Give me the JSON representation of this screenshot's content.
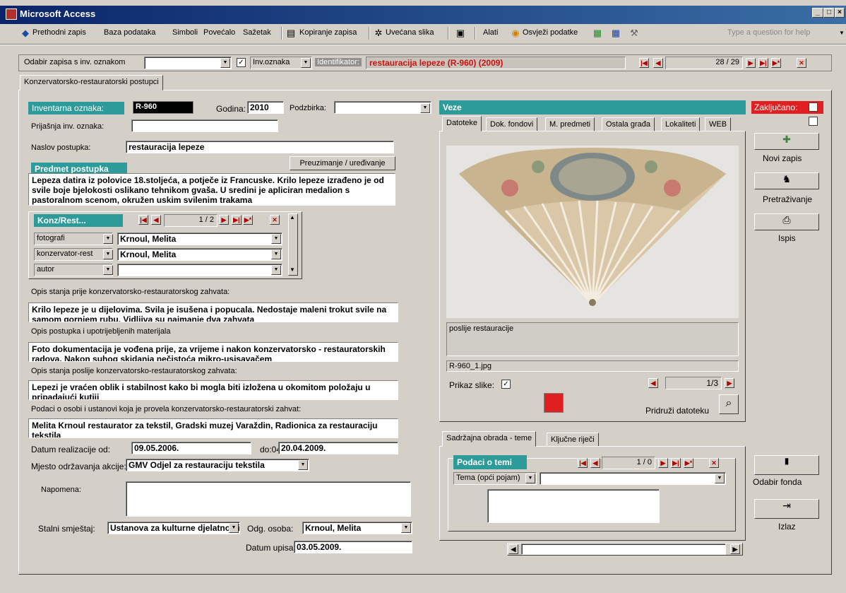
{
  "window": {
    "title": "Microsoft Access"
  },
  "menu": {
    "items": [
      "Prethodni zapis",
      "Baza podataka",
      "Simboli",
      "Povećalo",
      "Sažetak",
      "Kopiranje zapisa",
      "Uvećana slika",
      "Alati",
      "Osvježi podatke"
    ],
    "question_placeholder": "Type a question for help"
  },
  "record_bar": {
    "selector_label": "Odabir zapisa s inv. oznakom",
    "selector_value": "",
    "inv_oznaka_option": "Inv.oznaka",
    "inv_oznaka_checked": true,
    "identifier_label": "Identifikator:",
    "identifier_value": "restauracija lepeze (R-960) (2009)",
    "position": "28 / 29"
  },
  "form_tab": "Konzervatorsko-restauratorski postupci",
  "fields": {
    "inv_label": "Inventarna oznaka:",
    "inv_value": "R-960",
    "godina_label": "Godina:",
    "godina_value": "2010",
    "podzbirka_label": "Podzbirka:",
    "podzbirka_value": "",
    "prijasnja_label": "Prijašnja inv. oznaka:",
    "prijasnja_value": "",
    "naslov_label": "Naslov postupka:",
    "naslov_value": "restauracija lepeze",
    "preuzimanje_button": "Preuzimanje / uređivanje",
    "predmet_label": "Predmet postupka",
    "predmet_text": "Lepeza datira iz polovice 18.stoljeća, a potječe iz Francuske. Krilo lepeze izrađeno je od svile boje bjelokosti oslikano tehnikom gvaša. U sredini je apliciran medalion s pastoralnom scenom, okružen uskim svilenim trakama",
    "konz_label": "Konz/Rest...",
    "konz_position": "1 / 2",
    "roles": [
      {
        "role": "fotografi",
        "name": "Krnoul, Melita"
      },
      {
        "role": "konzervator-rest",
        "name": "Krnoul, Melita"
      },
      {
        "role": "autor",
        "name": ""
      }
    ],
    "opis_prije_label": "Opis stanja prije konzervatorsko-restauratorskog zahvata:",
    "opis_prije_text": "Krilo lepeze je u dijelovima. Svila je isušena i popucala. Nedostaje maleni trokut svile na samom gornjem rubu. Vidljiva su najmanje dva zahvata",
    "opis_postupka_label": "Opis postupka i upotrijebljenih materijala",
    "opis_postupka_text": "Foto dokumentacija je vođena prije, za vrijeme i nakon konzervatorsko - restauratorskih radova. Nakon suhog skidanja nečistoća mikro-usisavačem",
    "opis_poslije_label": "Opis stanja poslije konzervatorsko-restauratorskog zahvata:",
    "opis_poslije_text": "Lepezi je vraćen oblik i stabilnost kako bi mogla biti izložena u okomitom položaju u pripadajući kutiji",
    "podaci_osobi_label": "Podaci o osobi i ustanovi koja je provela konzervatorsko-restauratorski zahvat:",
    "podaci_osobi_text": "Melita Krnoul restaurator za tekstil, Gradski muzej Varaždin, Radionica za restauraciju tekstila",
    "datum_od_label": "Datum realizacije od:",
    "datum_od_value": "09.05.2006.",
    "datum_do_label": "do:",
    "datum_do_value": "20.04.2009.",
    "mjesto_label": "Mjesto održavanja akcije:",
    "mjesto_value": "GMV Odjel za restauraciju tekstila",
    "napomena_label": "Napomena:",
    "napomena_value": "",
    "smjestaj_label": "Stalni smještaj:",
    "smjestaj_value": "Ustanova za kulturne djelatnosti",
    "odg_label": "Odg. osoba:",
    "odg_value": "Krnoul, Melita",
    "datum_upisa_label": "Datum upisa:",
    "datum_upisa_value": "03.05.2009."
  },
  "veze": {
    "title": "Veze",
    "locked_label": "Zaključano:",
    "tabs": [
      "Datoteke",
      "Dok. fondovi",
      "M. predmeti",
      "Ostala građa",
      "Lokaliteti",
      "WEB"
    ],
    "caption": "poslije restauracije",
    "filename": "R-960_1.jpg",
    "prikaz_label": "Prikaz slike:",
    "prikaz_checked": true,
    "image_position": "1/3",
    "pridruzi_label": "Pridruži datoteku"
  },
  "side_buttons": {
    "novi": "Novi zapis",
    "pretrazivanje": "Pretraživanje",
    "ispis": "Ispis",
    "odabir": "Odabir fonda",
    "izlaz": "Izlaz"
  },
  "teme": {
    "tabs": [
      "Sadržajna obrada - teme",
      "Ključne riječi"
    ],
    "header": "Podaci o temi",
    "position": "1 / 0",
    "tema_label": "Tema (opći pojam)",
    "tema_value": ""
  },
  "colors": {
    "teal": "#2e9b9b",
    "identifier_red": "#cc1010",
    "locked_red": "#e02020"
  }
}
